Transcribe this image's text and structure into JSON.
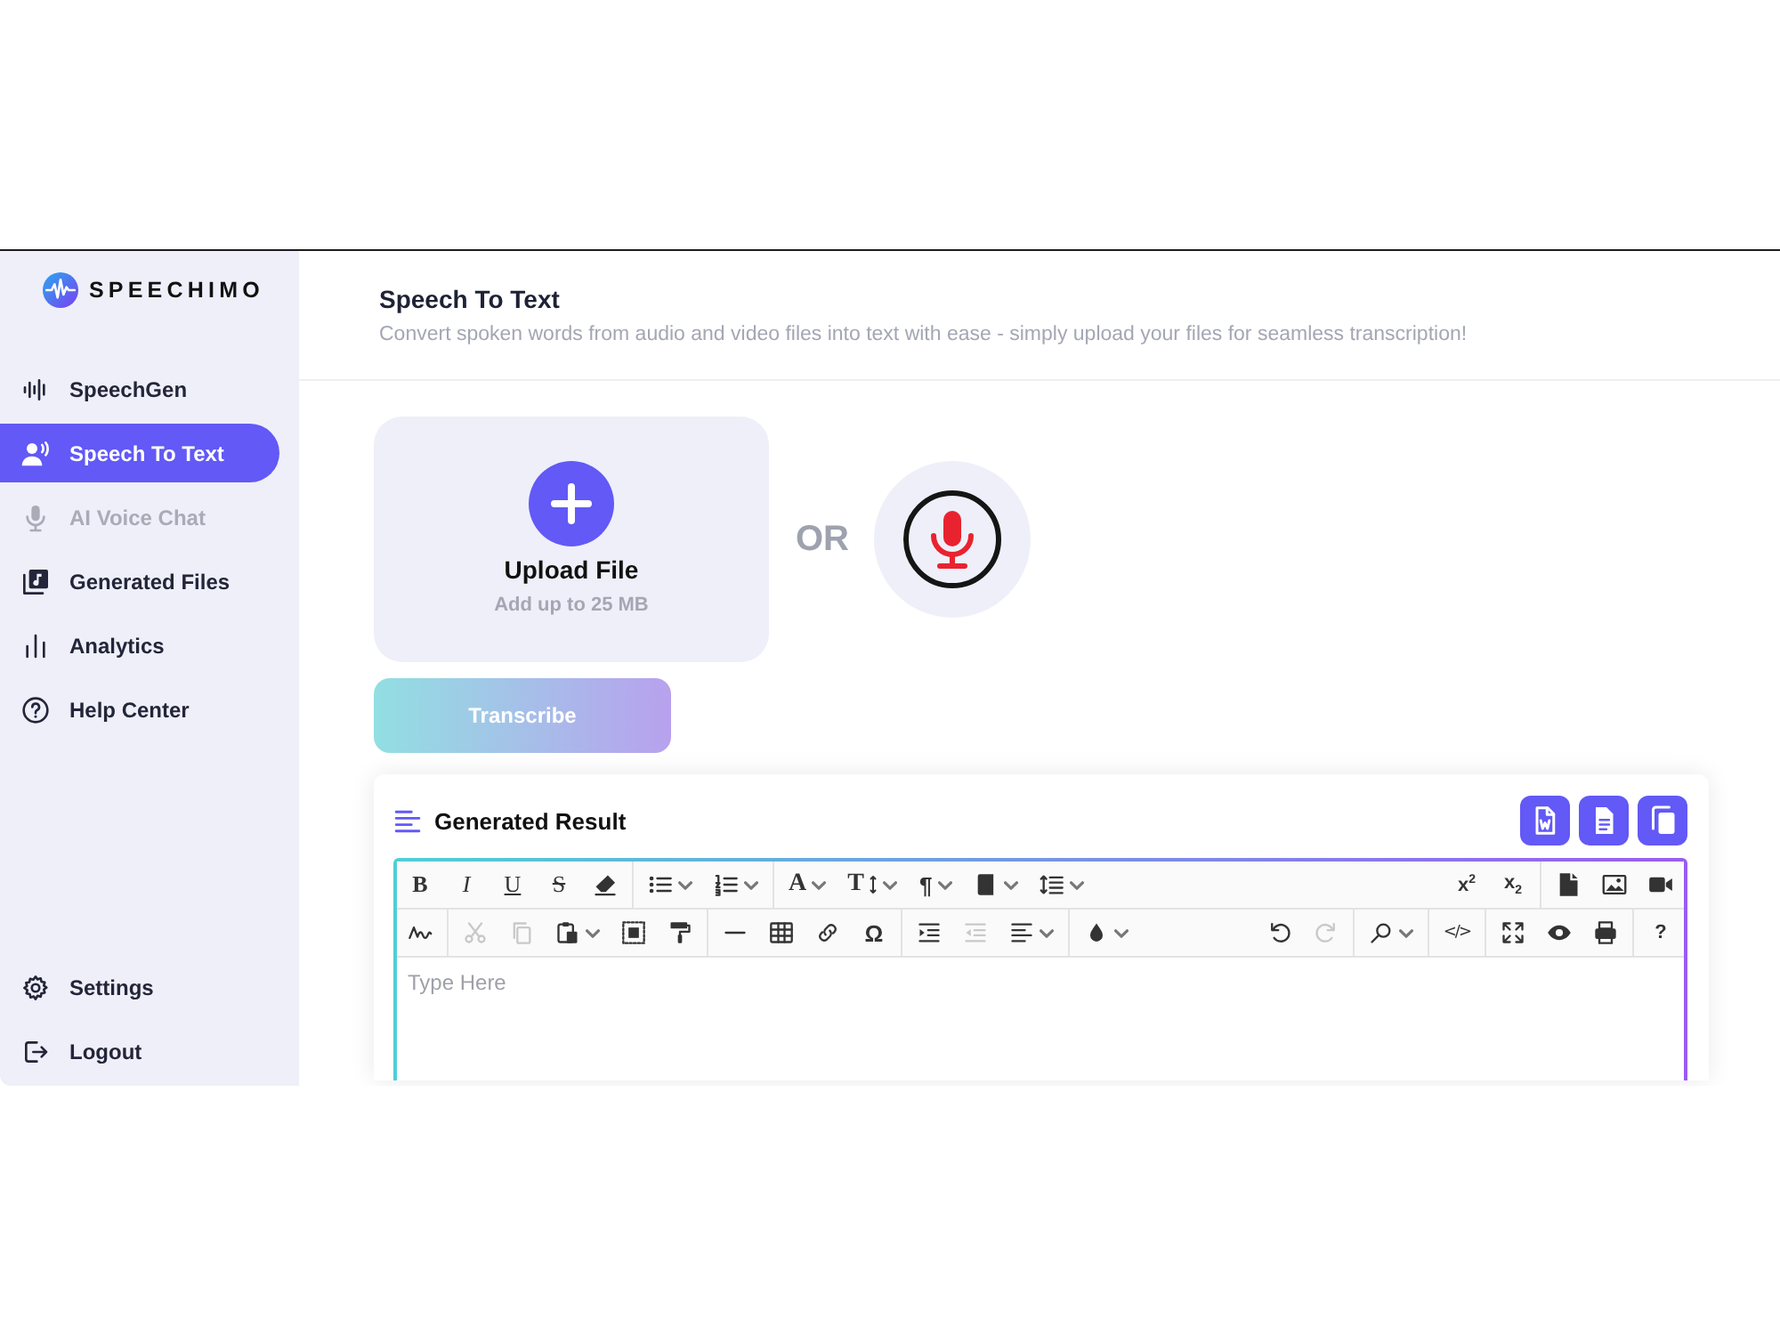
{
  "sidebar": {
    "logo": "SPEECHIMO",
    "nav": [
      {
        "label": "SpeechGen",
        "kind": "waveform",
        "selected": false,
        "disabled": false
      },
      {
        "label": "Speech To Text",
        "kind": "speaker",
        "selected": true,
        "disabled": false
      },
      {
        "label": "AI Voice Chat",
        "kind": "mic",
        "selected": false,
        "disabled": true
      },
      {
        "label": "Generated Files",
        "kind": "library",
        "selected": false,
        "disabled": false
      },
      {
        "label": "Analytics",
        "kind": "chart",
        "selected": false,
        "disabled": false
      },
      {
        "label": "Help Center",
        "kind": "help",
        "selected": false,
        "disabled": false
      }
    ],
    "footer": [
      {
        "label": "Settings",
        "kind": "settings"
      },
      {
        "label": "Logout",
        "kind": "logout"
      }
    ]
  },
  "header": {
    "title": "Speech To Text",
    "subtitle": "Convert spoken words from audio and video files into text with ease - simply upload your files for seamless transcription!"
  },
  "upload": {
    "title": "Upload File",
    "hint": "Add up to 25 MB",
    "separator": "OR",
    "button": "Transcribe"
  },
  "result": {
    "title": "Generated Result",
    "editor": {
      "placeholder": "Type Here",
      "toolbar": [
        {
          "left": [
            [
              {
                "kind": "bold",
                "label": "B",
                "disabled": false,
                "dropdown": false
              },
              {
                "kind": "italic",
                "label": "I",
                "disabled": false,
                "dropdown": false
              },
              {
                "kind": "underline",
                "label": "U",
                "disabled": false,
                "dropdown": false
              },
              {
                "kind": "strike",
                "label": "S",
                "disabled": false,
                "dropdown": false
              },
              {
                "kind": "eraser",
                "disabled": false,
                "dropdown": false
              }
            ],
            [
              {
                "kind": "bullets",
                "disabled": false,
                "dropdown": true
              },
              {
                "kind": "numbered",
                "disabled": false,
                "dropdown": true
              }
            ],
            [
              {
                "kind": "fontcolor",
                "label": "A",
                "disabled": false,
                "dropdown": true
              },
              {
                "kind": "fontsize",
                "label": "T",
                "disabled": false,
                "dropdown": true
              },
              {
                "kind": "paragraph",
                "label": "¶",
                "disabled": false,
                "dropdown": true
              },
              {
                "kind": "block",
                "disabled": false,
                "dropdown": true
              },
              {
                "kind": "lineheight",
                "disabled": false,
                "dropdown": true
              }
            ]
          ],
          "right": [
            [
              {
                "kind": "superscript",
                "label": "x$^{2}$",
                "disabled": false,
                "dropdown": false
              },
              {
                "kind": "subscript",
                "label": "x$_{2}$",
                "disabled": false,
                "dropdown": false
              }
            ],
            [
              {
                "kind": "file",
                "disabled": false,
                "dropdown": false
              },
              {
                "kind": "image",
                "disabled": false,
                "dropdown": false
              },
              {
                "kind": "video",
                "disabled": false,
                "dropdown": false
              }
            ]
          ]
        },
        {
          "left": [
            [
              {
                "kind": "template",
                "disabled": false,
                "dropdown": false
              }
            ],
            [
              {
                "kind": "cut",
                "disabled": true,
                "dropdown": false
              },
              {
                "kind": "copy",
                "disabled": true,
                "dropdown": false
              },
              {
                "kind": "paste",
                "disabled": false,
                "dropdown": true
              },
              {
                "kind": "selectall",
                "disabled": false,
                "dropdown": false
              },
              {
                "kind": "painter",
                "disabled": false,
                "dropdown": false
              }
            ],
            [
              {
                "kind": "hr",
                "disabled": false,
                "dropdown": false
              },
              {
                "kind": "table",
                "disabled": false,
                "dropdown": false
              },
              {
                "kind": "link",
                "disabled": false,
                "dropdown": false
              },
              {
                "kind": "special",
                "label": "Ω",
                "disabled": false,
                "dropdown": false
              }
            ],
            [
              {
                "kind": "indent",
                "disabled": false,
                "dropdown": false
              },
              {
                "kind": "outdent",
                "disabled": true,
                "dropdown": false
              },
              {
                "kind": "align",
                "disabled": false,
                "dropdown": true
              }
            ],
            [
              {
                "kind": "highlight",
                "disabled": false,
                "dropdown": true
              }
            ]
          ],
          "right": [
            [
              {
                "kind": "undo",
                "disabled": false,
                "dropdown": false
              },
              {
                "kind": "redo",
                "disabled": true,
                "dropdown": false
              }
            ],
            [
              {
                "kind": "search",
                "disabled": false,
                "dropdown": true
              }
            ],
            [
              {
                "kind": "code",
                "label": "</>",
                "disabled": false,
                "dropdown": false
              }
            ],
            [
              {
                "kind": "fullscreen",
                "disabled": false,
                "dropdown": false
              },
              {
                "kind": "preview",
                "disabled": false,
                "dropdown": false
              },
              {
                "kind": "print",
                "disabled": false,
                "dropdown": false
              }
            ],
            [
              {
                "kind": "help",
                "label": "?",
                "disabled": false,
                "dropdown": false
              }
            ]
          ]
        }
      ]
    }
  }
}
